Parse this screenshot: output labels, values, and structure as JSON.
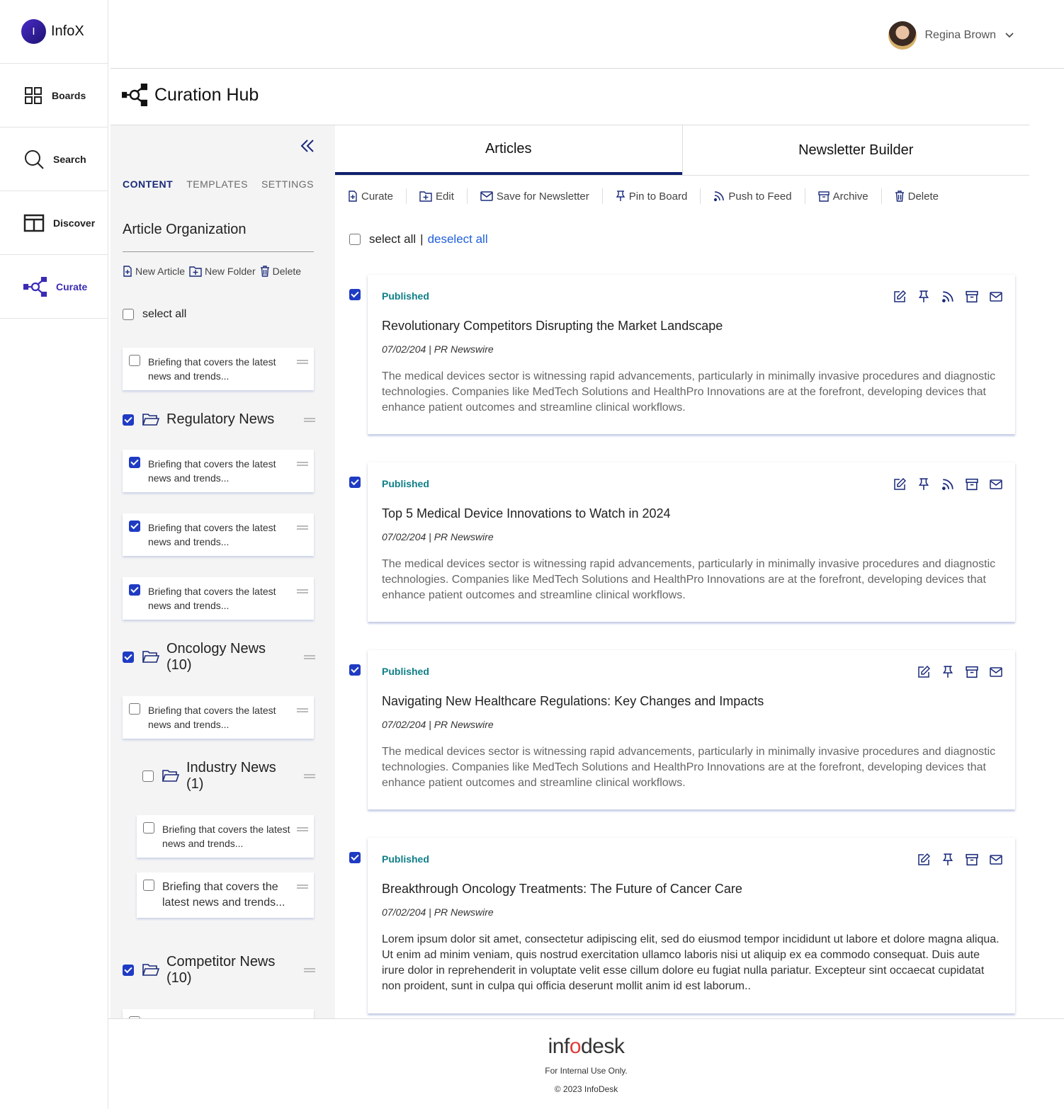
{
  "app": {
    "logo_letter": "I",
    "logo_text": "InfoX"
  },
  "nav": [
    {
      "label": "Boards",
      "icon": "grid-icon"
    },
    {
      "label": "Search",
      "icon": "search-icon"
    },
    {
      "label": "Discover",
      "icon": "columns-icon"
    },
    {
      "label": "Curate",
      "icon": "network-icon",
      "active": true
    }
  ],
  "user": {
    "name": "Regina Brown"
  },
  "page": {
    "title": "Curation Hub"
  },
  "panel": {
    "tabs": [
      "CONTENT",
      "TEMPLATES",
      "SETTINGS"
    ],
    "active_tab": "CONTENT",
    "org_title": "Article Organization",
    "actions": {
      "new_article": "New Article",
      "new_folder": "New Folder",
      "delete": "Delete"
    },
    "select_all": "select all",
    "brief": "Briefing that covers the latest news and trends...",
    "brief_narrow": "Briefing that covers the latest news and trends...",
    "folders": {
      "regulatory": "Regulatory News",
      "oncology": "Oncology News (10)",
      "industry": "Industry News (1)",
      "competitor": "Competitor News (10)"
    }
  },
  "tabs": {
    "articles": "Articles",
    "newsletter": "Newsletter Builder"
  },
  "toolbar": {
    "curate": "Curate",
    "edit": "Edit",
    "save": "Save for Newsletter",
    "pin": "Pin to Board",
    "push": "Push to Feed",
    "archive": "Archive",
    "delete": "Delete"
  },
  "selection": {
    "select_all": "select all",
    "separator": "|",
    "deselect_all": "deselect all"
  },
  "articles": [
    {
      "status": "Published",
      "title": "Revolutionary Competitors Disrupting the Market Landscape",
      "meta": "07/02/204 | PR Newswire",
      "body": "The medical devices sector is witnessing rapid advancements, particularly in minimally invasive procedures and diagnostic technologies. Companies like MedTech Solutions and HealthPro Innovations are at the forefront, developing devices that enhance patient outcomes and streamline clinical workflows."
    },
    {
      "status": "Published",
      "title": "Top 5 Medical Device Innovations to Watch in 2024",
      "meta": "07/02/204 | PR Newswire",
      "body": "The medical devices sector is witnessing rapid advancements, particularly in minimally invasive procedures and diagnostic technologies. Companies like MedTech Solutions and HealthPro Innovations are at the forefront, developing devices that enhance patient outcomes and streamline clinical workflows."
    },
    {
      "status": "Published",
      "title": "Navigating New Healthcare Regulations: Key Changes and Impacts",
      "meta": "07/02/204 | PR Newswire",
      "body": "The medical devices sector is witnessing rapid advancements, particularly in minimally invasive procedures and diagnostic technologies. Companies like MedTech Solutions and HealthPro Innovations are at the forefront, developing devices that enhance patient outcomes and streamline clinical workflows."
    },
    {
      "status": "Published",
      "title": "Breakthrough Oncology Treatments: The Future of Cancer Care",
      "meta": "07/02/204 | PR Newswire",
      "body": "Lorem ipsum dolor sit amet, consectetur adipiscing elit, sed do eiusmod tempor incididunt ut labore et dolore magna aliqua. Ut enim ad minim veniam, quis nostrud exercitation ullamco laboris nisi ut aliquip ex ea commodo consequat. Duis aute irure dolor in reprehenderit in voluptate velit esse cillum dolore eu fugiat nulla pariatur. Excepteur sint occaecat cupidatat non proident, sunt in culpa qui officia deserunt mollit anim id est laborum.."
    }
  ],
  "footer": {
    "logo_pre": "inf",
    "logo_o": "o",
    "logo_post": "desk",
    "line": "For Internal Use Only.",
    "copyright": "© 2023 InfoDesk"
  },
  "colors": {
    "primary": "#1f3bc3",
    "nav_active": "#3a2bb5",
    "status": "#0f7f88",
    "link": "#1f5fdc"
  }
}
